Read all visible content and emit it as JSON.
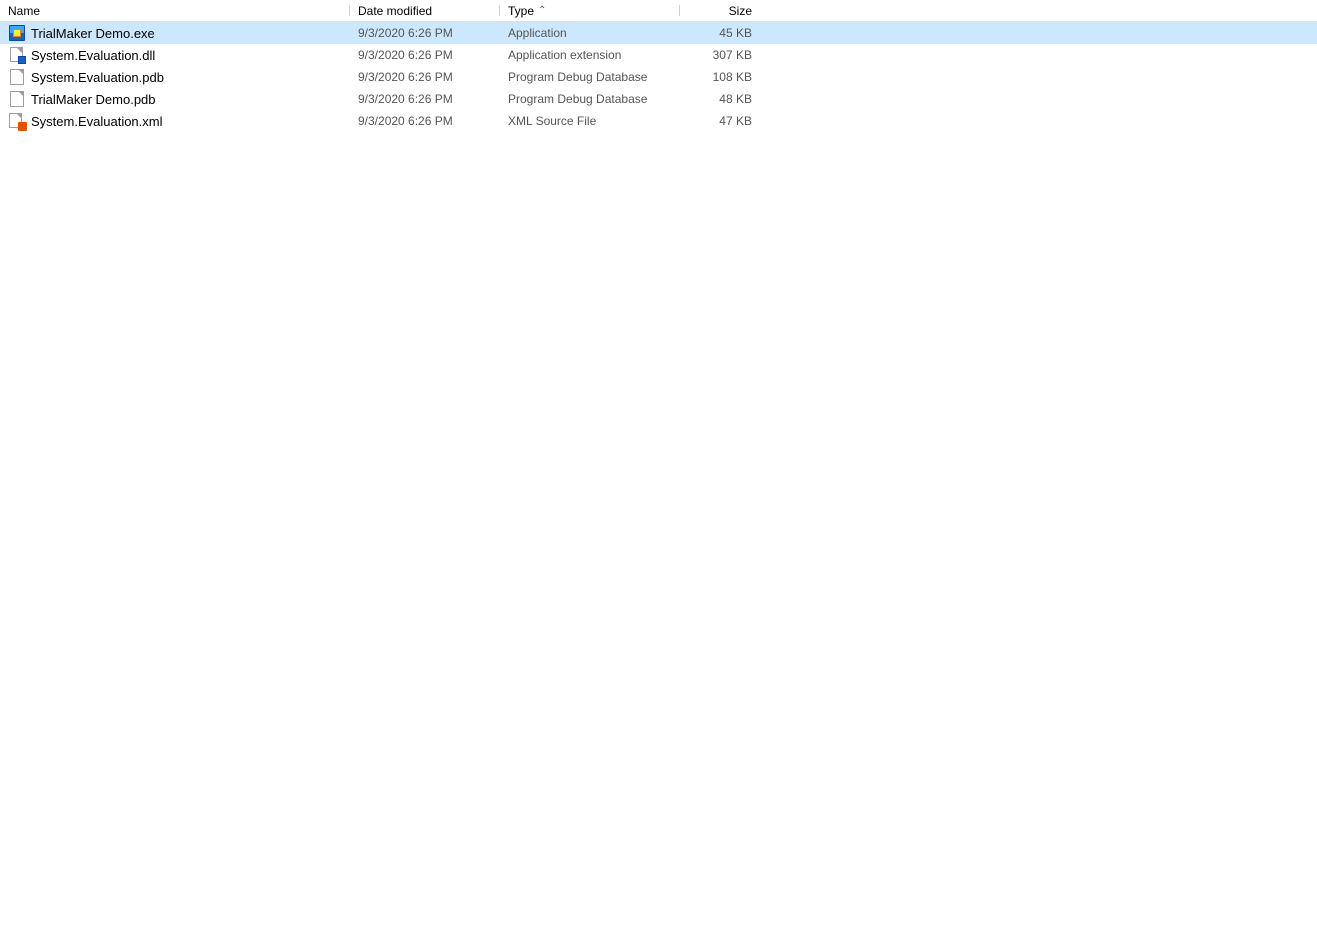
{
  "columns": [
    {
      "id": "name",
      "label": "Name",
      "sortable": true,
      "sort_direction": null
    },
    {
      "id": "date_modified",
      "label": "Date modified",
      "sortable": true,
      "sort_direction": null
    },
    {
      "id": "type",
      "label": "Type",
      "sortable": true,
      "sort_direction": "asc"
    },
    {
      "id": "size",
      "label": "Size",
      "sortable": true,
      "sort_direction": null
    }
  ],
  "files": [
    {
      "name": "TrialMaker Demo.exe",
      "date_modified": "9/3/2020 6:26 PM",
      "type": "Application",
      "size": "45 KB",
      "icon": "exe",
      "selected": true
    },
    {
      "name": "System.Evaluation.dll",
      "date_modified": "9/3/2020 6:26 PM",
      "type": "Application extension",
      "size": "307 KB",
      "icon": "dll",
      "selected": false
    },
    {
      "name": "System.Evaluation.pdb",
      "date_modified": "9/3/2020 6:26 PM",
      "type": "Program Debug Database",
      "size": "108 KB",
      "icon": "file",
      "selected": false
    },
    {
      "name": "TrialMaker Demo.pdb",
      "date_modified": "9/3/2020 6:26 PM",
      "type": "Program Debug Database",
      "size": "48 KB",
      "icon": "file",
      "selected": false
    },
    {
      "name": "System.Evaluation.xml",
      "date_modified": "9/3/2020 6:26 PM",
      "type": "XML Source File",
      "size": "47 KB",
      "icon": "xml",
      "selected": false
    }
  ]
}
